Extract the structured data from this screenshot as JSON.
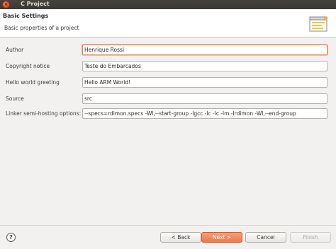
{
  "window": {
    "title": "C Project",
    "close_glyph": "×"
  },
  "header": {
    "title": "Basic Settings",
    "description": "Basic properties of a project",
    "icon": "wizard-banner-icon"
  },
  "form": {
    "author_label": "Author",
    "author_value": "Henrique Rossi",
    "copyright_label": "Copyright notice",
    "copyright_value": "Teste do Embarcados",
    "greeting_label": "Hello world greeting",
    "greeting_value": "Hello ARM World!",
    "source_label": "Source",
    "source_value": "src",
    "linker_label": "Linker semi-hosting options:",
    "linker_value": "--specs=rdimon.specs -Wl,--start-group -lgcc -lc -lc -lm -lrdimon -Wl,--end-group"
  },
  "footer": {
    "help_glyph": "?",
    "back_label": "< Back",
    "next_label": "Next >",
    "cancel_label": "Cancel",
    "finish_label": "Finish"
  },
  "colors": {
    "accent": "#ef7749",
    "titlebar": "#3e3d39"
  }
}
